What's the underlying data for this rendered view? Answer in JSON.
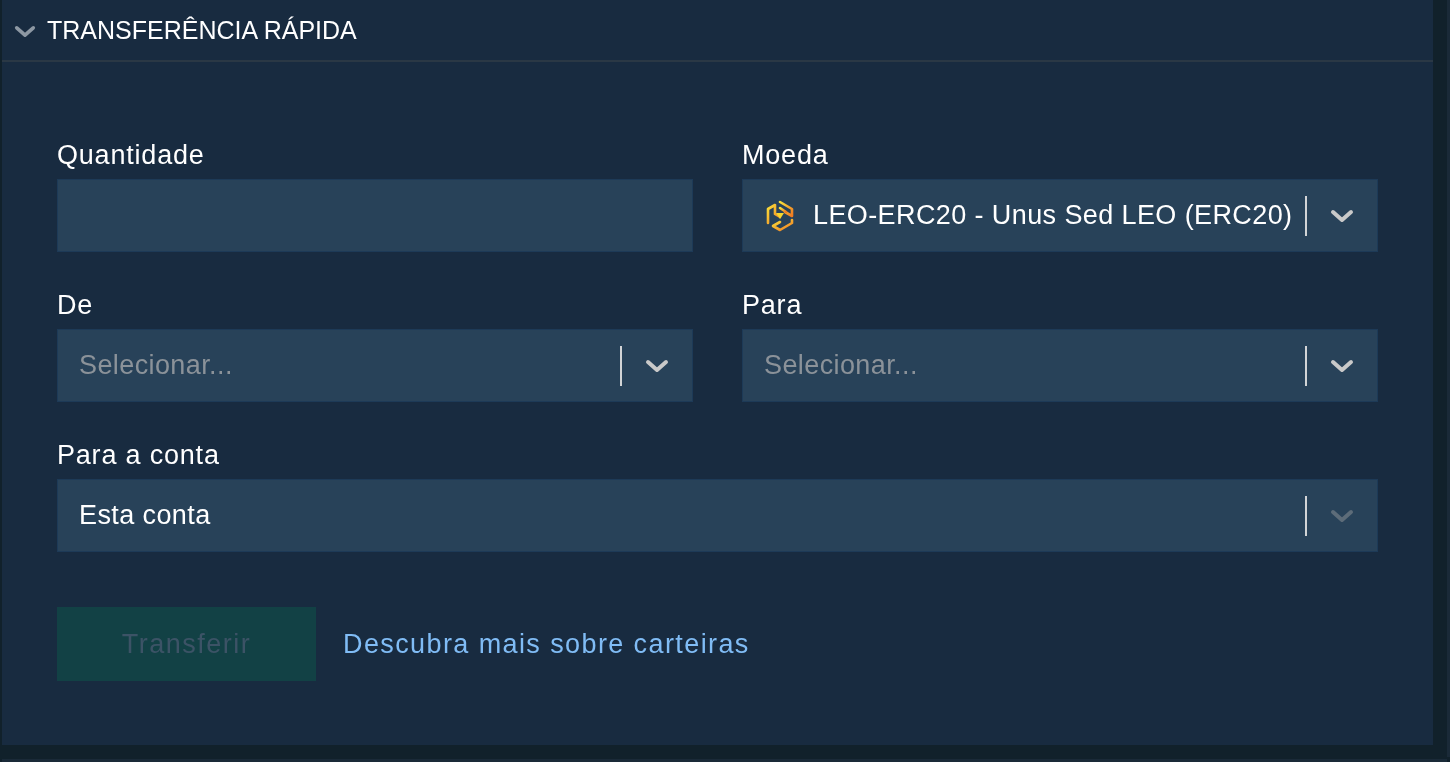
{
  "panel": {
    "title": "TRANSFERÊNCIA RÁPIDA",
    "expanded": true
  },
  "form_rows": [
    [
      {
        "kind": "input",
        "label": "Quantidade",
        "disabled": false
      },
      {
        "kind": "coin-select",
        "label": "Moeda",
        "value": "LEO-ERC20 - Unus Sed LEO (ERC20)",
        "disabled": false
      }
    ],
    [
      {
        "kind": "select",
        "label": "De",
        "placeholder": "Selecionar...",
        "disabled": false
      },
      {
        "kind": "select",
        "label": "Para",
        "placeholder": "Selecionar...",
        "disabled": false
      }
    ],
    [
      {
        "kind": "select",
        "label": "Para a conta",
        "value": "Esta conta",
        "disabled": true
      }
    ]
  ],
  "actions": {
    "button": {
      "label": "Transferir",
      "disabled": true
    },
    "link": "Descubra mais sobre carteiras"
  }
}
